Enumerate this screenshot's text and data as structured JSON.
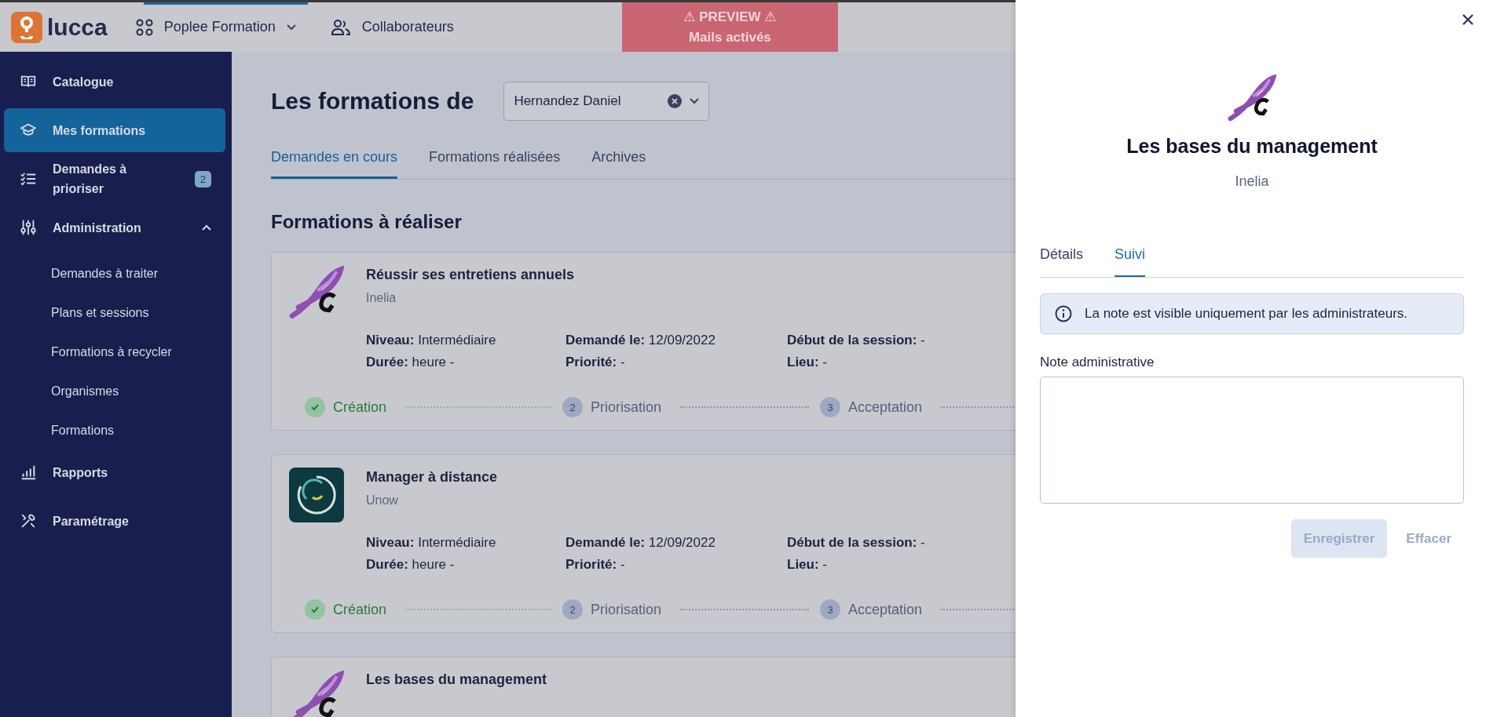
{
  "top_bar": {
    "logo": "lucca",
    "app_switcher": "Poplee Formation",
    "links": [
      "Collaborateurs"
    ],
    "preview_banner": {
      "title": "⚠ PREVIEW ⚠",
      "subtitle": "Mails activés"
    }
  },
  "sidebar": {
    "items": [
      {
        "label": "Catalogue",
        "selected": false
      },
      {
        "label": "Mes formations",
        "selected": true
      },
      {
        "label": "Demandes à prioriser",
        "selected": false,
        "badge": "2"
      },
      {
        "label": "Administration",
        "selected": false,
        "expanded": true,
        "children": [
          {
            "label": "Demandes à traiter",
            "selected": false
          },
          {
            "label": "Plans et sessions",
            "selected": false
          },
          {
            "label": "Formations à recycler",
            "selected": false
          },
          {
            "label": "Organismes",
            "selected": false
          },
          {
            "label": "Formations",
            "selected": false
          }
        ]
      },
      {
        "label": "Rapports",
        "selected": false
      },
      {
        "label": "Paramétrage",
        "selected": false
      }
    ]
  },
  "main": {
    "title": "Les formations de",
    "person_select": {
      "value": "Hernandez Daniel"
    },
    "tabs": [
      {
        "label": "Demandes en cours",
        "selected": true
      },
      {
        "label": "Formations réalisées",
        "selected": false
      },
      {
        "label": "Archives",
        "selected": false
      }
    ],
    "section_title": "Formations à réaliser",
    "cards": [
      {
        "kind": "quill",
        "title": "Réussir ses entretiens annuels",
        "provider": "Inelia",
        "fields": [
          {
            "label": "Niveau:",
            "value": "Intermédiaire"
          },
          {
            "label": "Demandé le:",
            "value": "12/09/2022"
          },
          {
            "label": "Début de la session:",
            "value": "-"
          },
          {
            "label": "Durée:",
            "value": "heure -"
          },
          {
            "label": "Priorité:",
            "value": "-"
          },
          {
            "label": "Lieu:",
            "value": "-"
          }
        ],
        "steps": [
          {
            "label": "Création",
            "done": true
          },
          {
            "number": "2",
            "label": "Priorisation",
            "done": false
          },
          {
            "number": "3",
            "label": "Acceptation",
            "done": false
          }
        ]
      },
      {
        "kind": "arcs",
        "title": "Manager à distance",
        "provider": "Unow",
        "fields": [
          {
            "label": "Niveau:",
            "value": "Intermédiaire"
          },
          {
            "label": "Demandé le:",
            "value": "12/09/2022"
          },
          {
            "label": "Début de la session:",
            "value": "-"
          },
          {
            "label": "Durée:",
            "value": "heure -"
          },
          {
            "label": "Priorité:",
            "value": "-"
          },
          {
            "label": "Lieu:",
            "value": "-"
          }
        ],
        "steps": [
          {
            "label": "Création",
            "done": true
          },
          {
            "number": "2",
            "label": "Priorisation",
            "done": false
          },
          {
            "number": "3",
            "label": "Acceptation",
            "done": false
          }
        ]
      },
      {
        "kind": "quill",
        "title": "Les bases du management"
      }
    ]
  },
  "panel": {
    "title": "Les bases du management",
    "provider": "Inelia",
    "tabs": [
      {
        "label": "Détails",
        "selected": false
      },
      {
        "label": "Suivi",
        "selected": true
      }
    ],
    "info": "La note est visible uniquement par les administrateurs.",
    "note_label": "Note administrative",
    "buttons": [
      {
        "label": "Enregistrer",
        "kind": "primary",
        "disabled": true
      },
      {
        "label": "Effacer",
        "kind": "link",
        "disabled": true
      }
    ]
  }
}
